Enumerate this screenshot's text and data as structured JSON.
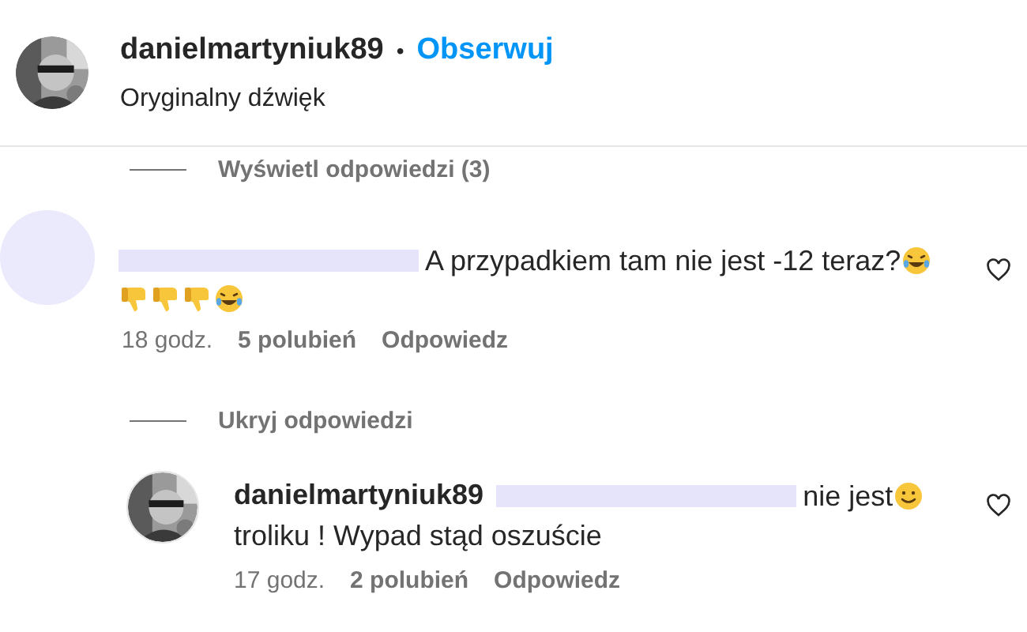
{
  "header": {
    "username": "danielmartyniuk89",
    "separator": "•",
    "follow_link": "Obserwuj",
    "audio": "Oryginalny dźwięk"
  },
  "thread_toggle": {
    "label": "Wyświetl odpowiedzi (3)"
  },
  "comment": {
    "avatar_redacted": true,
    "lines": [
      [
        {
          "kind": "redaction"
        },
        {
          "kind": "text",
          "text": "A przypadkiem tam nie jest -12 teraz?"
        },
        {
          "kind": "laugh"
        }
      ],
      [
        {
          "kind": "thumbs_down"
        },
        {
          "kind": "thumbs_down"
        },
        {
          "kind": "thumbs_down"
        },
        {
          "kind": "laugh"
        }
      ]
    ],
    "time": "18 godz.",
    "likes": "5 polubień",
    "reply": "Odpowiedz"
  },
  "replies_toggle": {
    "label": "Ukryj odpowiedzi"
  },
  "reply": {
    "avatar_redacted": false,
    "username": "danielmartyniuk89",
    "lines": [
      [
        {
          "kind": "redaction"
        },
        {
          "kind": "text",
          "text": "nie jest"
        },
        {
          "kind": "smile"
        }
      ],
      [
        {
          "kind": "text",
          "text": "troliku ! Wypad stąd oszuście"
        }
      ]
    ],
    "time": "17 godz.",
    "likes": "2 polubień",
    "reply": "Odpowiedz"
  }
}
